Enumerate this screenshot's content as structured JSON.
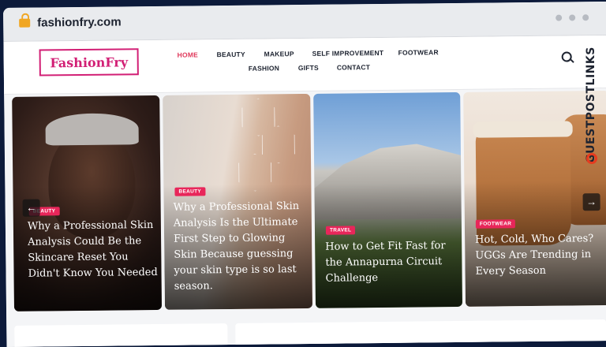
{
  "browser": {
    "url": "fashionfry.com"
  },
  "site": {
    "logo_text": "FashionFry",
    "nav": [
      "HOME",
      "BEAUTY",
      "MAKEUP",
      "SELF IMPROVEMENT",
      "FOOTWEAR",
      "FASHION",
      "GIFTS",
      "CONTACT"
    ],
    "active_nav": "HOME"
  },
  "slides": [
    {
      "category": "BEAUTY",
      "title": "Why a Professional Skin Analysis Could Be the Skincare Reset You Didn't Know You Needed"
    },
    {
      "category": "BEAUTY",
      "title": "Why a Professional Skin Analysis Is the Ultimate First Step to Glowing Skin Because guessing your skin type is so last season."
    },
    {
      "category": "TRAVEL",
      "title": "How to Get Fit Fast for the Annapurna Circuit Challenge"
    },
    {
      "category": "FOOTWEAR",
      "title": "Hot, Cold, Who Cares? UGGs Are Trending in Every Season"
    }
  ],
  "slider_controls": {
    "prev": "←",
    "next": "→"
  },
  "watermark": "GUESTPOSTLINKS",
  "colors": {
    "accent": "#e8265a",
    "logo": "#d21f75",
    "lock": "#f0a623"
  }
}
